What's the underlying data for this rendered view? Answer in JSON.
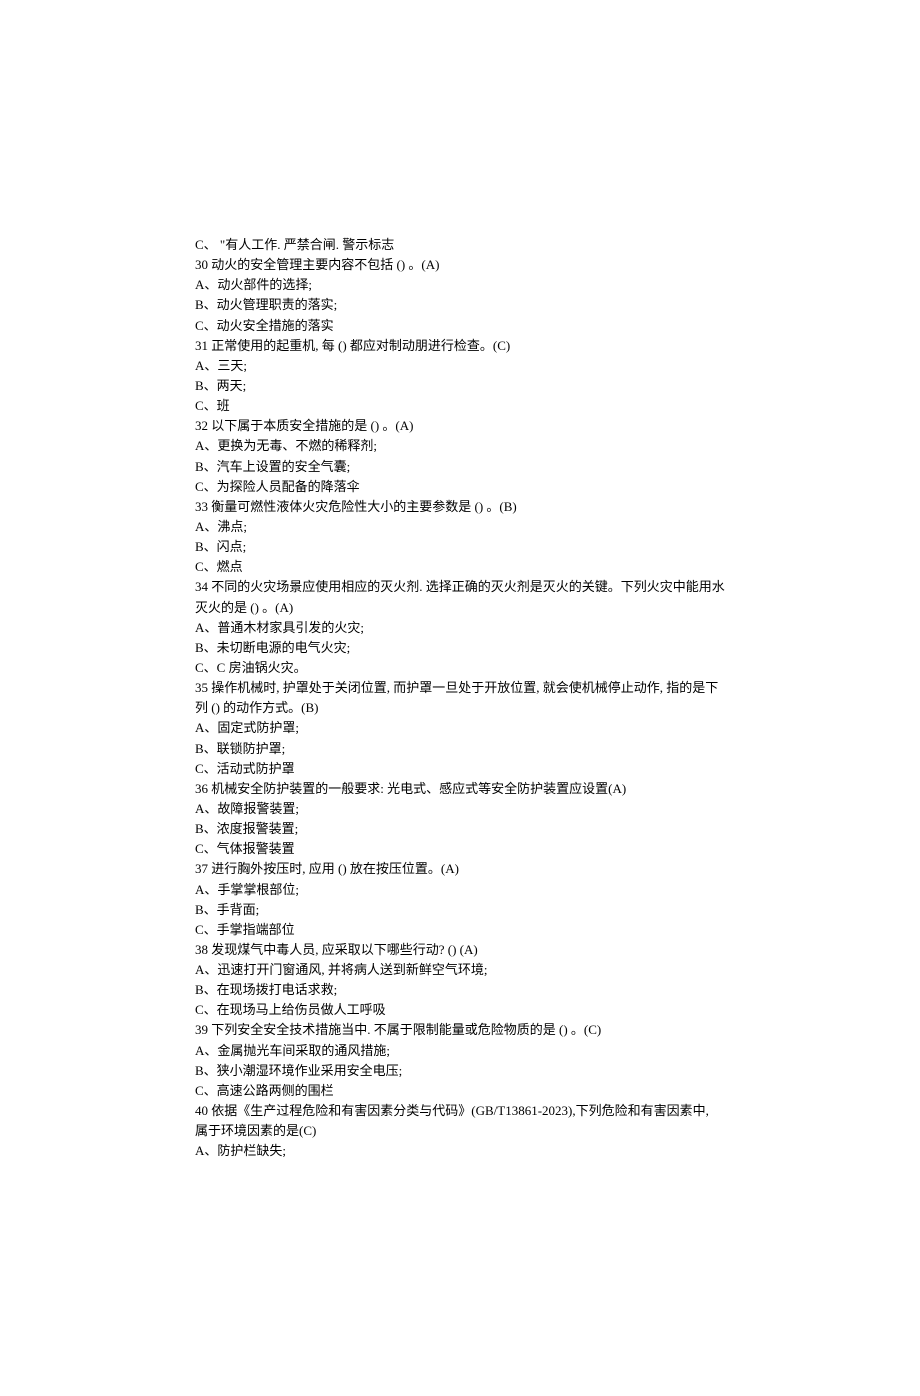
{
  "lines": [
    "C、 \"有人工作. 严禁合闸. 警示标志",
    "30 动火的安全管理主要内容不包括 () 。(A)",
    "A、动火部件的选择;",
    "B、动火管理职责的落实;",
    "C、动火安全措施的落实",
    "31 正常使用的起重机, 每 () 都应对制动朋进行检查。(C)",
    "A、三天;",
    "B、两天;",
    "C、班",
    "32 以下属于本质安全措施的是 () 。(A)",
    "A、更换为无毒、不燃的稀释剂;",
    "B、汽车上设置的安全气囊;",
    "C、为探险人员配备的降落伞",
    "33 衡量可燃性液体火灾危险性大小的主要参数是 () 。(B)",
    "A、沸点;",
    "B、闪点;",
    "C、燃点",
    "34 不同的火灾场景应使用相应的灭火剂. 选择正确的灭火剂是灭火的关键。下列火灾中能用水灭火的是 () 。(A)",
    "A、普通木材家具引发的火灾;",
    "B、未切断电源的电气火灾;",
    "C、C 房油锅火灾。",
    "35 操作机械时, 护罩处于关闭位置, 而护罩一旦处于开放位置, 就会使机械停止动作, 指的是下列 () 的动作方式。(B)",
    "A、固定式防护罩;",
    "B、联锁防护罩;",
    "C、活动式防护罩",
    "36 机械安全防护装置的一般要求: 光电式、感应式等安全防护装置应设置(A)",
    "A、故障报警装置;",
    "B、浓度报警装置;",
    "C、气体报警装置",
    "37 进行胸外按压时, 应用 () 放在按压位置。(A)",
    "A、手掌掌根部位;",
    "B、手背面;",
    "C、手掌指端部位",
    "38 发现煤气中毒人员, 应采取以下哪些行动?  () (A)",
    "A、迅速打开门窗通风, 并将病人送到新鲜空气环境;",
    "B、在现场拨打电话求救;",
    "C、在现场马上给伤员做人工呼吸",
    "39 下列安全安全技术措施当中. 不属于限制能量或危险物质的是 () 。(C)",
    "A、金属抛光车间采取的通风措施;",
    "B、狭小潮湿环境作业采用安全电压;",
    "C、高速公路两侧的围栏",
    "40 依据《生产过程危险和有害因素分类与代码》(GB/T13861-2023),下列危险和有害因素中, 属于环境因素的是(C)",
    "A、防护栏缺失;"
  ]
}
